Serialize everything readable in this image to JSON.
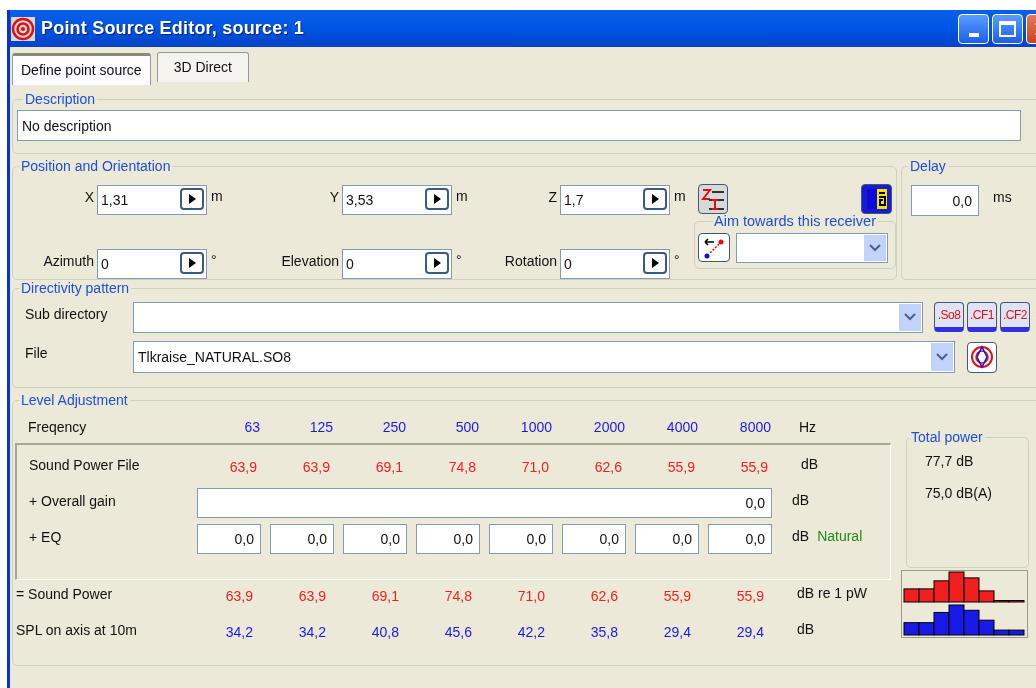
{
  "window": {
    "title": "Point Source Editor, source: 1"
  },
  "tabs": [
    {
      "label": "Define point source",
      "selected": true
    },
    {
      "label": "3D Direct",
      "selected": false
    }
  ],
  "description": {
    "title": "Description",
    "value": "No description"
  },
  "position": {
    "title": "Position and Orientation",
    "fields": [
      {
        "label": "X",
        "value": "1,31",
        "unit": "m"
      },
      {
        "label": "Y",
        "value": "3,53",
        "unit": "m"
      },
      {
        "label": "Z",
        "value": "1,7",
        "unit": "m"
      },
      {
        "label": "Azimuth",
        "value": "0",
        "unit": "°"
      },
      {
        "label": "Elevation",
        "value": "0",
        "unit": "°"
      },
      {
        "label": "Rotation",
        "value": "0",
        "unit": "°"
      }
    ],
    "aim": {
      "title": "Aim towards this receiver"
    }
  },
  "delay": {
    "title": "Delay",
    "value": "0,0",
    "unit": "ms"
  },
  "directivity": {
    "title": "Directivity pattern",
    "subdirectory": {
      "label": "Sub directory"
    },
    "file": {
      "label": "File",
      "value": "Tlkraise_NATURAL.SO8"
    },
    "format_buttons": [
      ".So8",
      ".CF1",
      ".CF2"
    ]
  },
  "level": {
    "title": "Level Adjustment",
    "frequency_label": "Freqency",
    "frequencies": [
      "63",
      "125",
      "250",
      "500",
      "1000",
      "2000",
      "4000",
      "8000"
    ],
    "frequency_unit": "Hz",
    "adjust_rows": [
      {
        "kind": "values",
        "label": "Sound Power File",
        "color": "#f02020",
        "values": [
          "63,9",
          "63,9",
          "69,1",
          "74,8",
          "71,0",
          "62,6",
          "55,9",
          "55,9"
        ],
        "unit": "dB"
      },
      {
        "kind": "gain",
        "label": "+ Overall gain",
        "value": "0,0",
        "unit": "dB"
      },
      {
        "kind": "eq",
        "label": "+ EQ",
        "values": [
          "0,0",
          "0,0",
          "0,0",
          "0,0",
          "0,0",
          "0,0",
          "0,0",
          "0,0"
        ],
        "unit": "dB",
        "preset": "Natural"
      }
    ],
    "result_rows": [
      {
        "kind": "values",
        "label": "= Sound Power",
        "color": "#f02020",
        "values": [
          "63,9",
          "63,9",
          "69,1",
          "74,8",
          "71,0",
          "62,6",
          "55,9",
          "55,9"
        ],
        "unit": "dB re 1 pW"
      },
      {
        "kind": "values",
        "label": "SPL on axis at 10m",
        "color": "#1a1ae6",
        "values": [
          "34,2",
          "34,2",
          "40,8",
          "45,6",
          "42,2",
          "35,8",
          "29,4",
          "29,4"
        ],
        "unit": "dB"
      }
    ],
    "total_power": {
      "title": "Total power",
      "values": [
        "77,7 dB",
        "75,0 dB(A)"
      ]
    }
  }
}
